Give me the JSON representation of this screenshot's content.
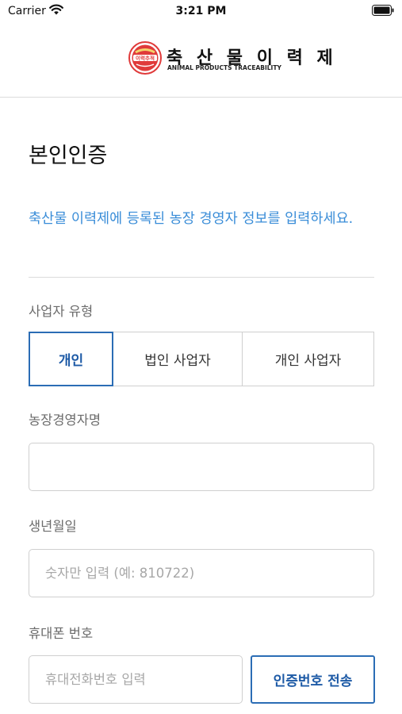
{
  "status_bar": {
    "carrier": "Carrier",
    "time": "3:21 PM",
    "wifi_icon": "wifi-icon",
    "battery_icon": "battery-icon"
  },
  "header": {
    "logo_title": "축 산 물 이 력 제",
    "logo_subtitle": "ANIMAL PRODUCTS TRACEABILITY",
    "seal_text": "이력추적",
    "seal_icon": "traceability-seal-logo",
    "brand_color": "#e03a3a"
  },
  "page": {
    "title": "본인인증",
    "instruction": "축산물 이력제에 등록된 농장 경영자 정보를 입력하세요.",
    "accent_color": "#3a8dd8"
  },
  "form": {
    "business_type": {
      "label": "사업자 유형",
      "options": [
        "개인",
        "법인 사업자",
        "개인 사업자"
      ],
      "selected": "개인"
    },
    "farm_manager_name": {
      "label": "농장경영자명",
      "value": "",
      "placeholder": ""
    },
    "birth_date": {
      "label": "생년월일",
      "value": "",
      "placeholder": "숫자만 입력 (예: 810722)"
    },
    "phone": {
      "label": "휴대폰 번호",
      "value": "",
      "placeholder": "휴대전화번호 입력",
      "send_button_label": "인증번호 전송"
    },
    "selected_color": "#2b6db5"
  }
}
